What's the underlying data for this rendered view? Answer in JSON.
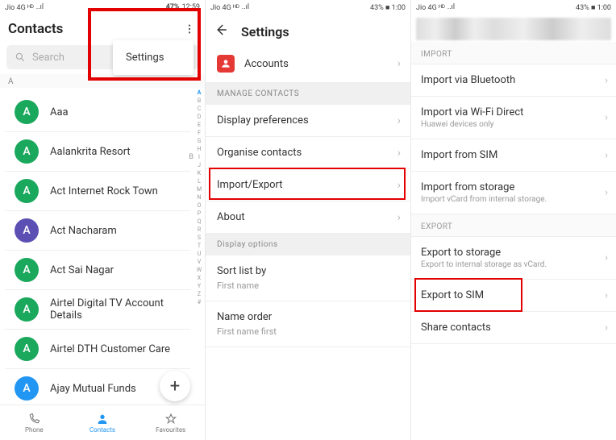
{
  "screen1": {
    "status": {
      "left": "Jio 4G ᴴᴰ",
      "signal": "..ıl",
      "right_pct": "47%",
      "right_time": "12:59"
    },
    "title": "Contacts",
    "search_placeholder": "Search",
    "menu": {
      "settings": "Settings"
    },
    "section_letter": "A",
    "alpha_b": "B",
    "contacts": [
      {
        "initial": "A",
        "name": "Aaa",
        "color": "green"
      },
      {
        "initial": "A",
        "name": "Aalankrita Resort",
        "color": "green"
      },
      {
        "initial": "A",
        "name": "Act Internet Rock Town",
        "color": "green"
      },
      {
        "initial": "A",
        "name": "Act Nacharam",
        "color": "purple"
      },
      {
        "initial": "A",
        "name": "Act Sai Nagar",
        "color": "green"
      },
      {
        "initial": "A",
        "name": "Airtel Digital TV Account Details",
        "color": "green"
      },
      {
        "initial": "A",
        "name": "Airtel DTH Customer Care",
        "color": "green"
      },
      {
        "initial": "A",
        "name": "Ajay Mutual Funds",
        "color": "blue"
      }
    ],
    "alpha_index": [
      "A",
      "B",
      "C",
      "D",
      "E",
      "F",
      "G",
      "H",
      "I",
      "J",
      "K",
      "L",
      "M",
      "N",
      "O",
      "P",
      "Q",
      "R",
      "S",
      "T",
      "U",
      "V",
      "W",
      "X",
      "Y",
      "Z",
      "#"
    ],
    "nav": {
      "phone": "Phone",
      "contacts": "Contacts",
      "favourites": "Favourites"
    },
    "fab": "+"
  },
  "screen2": {
    "status": {
      "left": "Jio 4G ᴴᴰ",
      "signal": "..ıl",
      "right": "43% ■ 1:00"
    },
    "title": "Settings",
    "accounts": "Accounts",
    "section_manage": "MANAGE CONTACTS",
    "rows_manage": [
      "Display preferences",
      "Organise contacts",
      "Import/Export",
      "About"
    ],
    "section_display": "Display options",
    "sort_list": {
      "title": "Sort list by",
      "sub": "First name"
    },
    "name_order": {
      "title": "Name order",
      "sub": "First name first"
    }
  },
  "screen3": {
    "status": {
      "left": "Jio 4G ᴴᴰ",
      "signal": "..ıl",
      "right": "43% ■ 1:00"
    },
    "section_import": "IMPORT",
    "import_rows": [
      {
        "title": "Import via Bluetooth",
        "sub": ""
      },
      {
        "title": "Import via Wi-Fi Direct",
        "sub": "Huawei devices only"
      },
      {
        "title": "Import from SIM",
        "sub": ""
      },
      {
        "title": "Import from storage",
        "sub": "Import vCard from internal storage."
      }
    ],
    "section_export": "EXPORT",
    "export_rows": [
      {
        "title": "Export to storage",
        "sub": "Export to internal storage as vCard."
      },
      {
        "title": "Export to SIM",
        "sub": ""
      },
      {
        "title": "Share contacts",
        "sub": ""
      }
    ]
  }
}
